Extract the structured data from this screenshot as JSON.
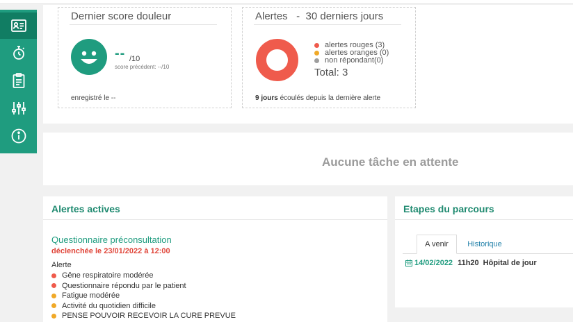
{
  "sidebar": {
    "items": [
      {
        "icon": "id-card-icon",
        "active": true
      },
      {
        "icon": "stopwatch-icon",
        "active": false
      },
      {
        "icon": "clipboard-icon",
        "active": false
      },
      {
        "icon": "sliders-icon",
        "active": false
      },
      {
        "icon": "info-icon",
        "active": false
      }
    ]
  },
  "pain_card": {
    "title": "Dernier score douleur",
    "score_value": "--",
    "score_denominator": "/10",
    "previous_score": "score précédent: --/10",
    "registered": "enregistré le --"
  },
  "alerts_card": {
    "title": "Alertes   -  30 derniers jours",
    "legend": [
      {
        "label": "alertes rouges (3)",
        "color": "#ef5b4c"
      },
      {
        "label": "alertes oranges (0)",
        "color": "#f0a928"
      },
      {
        "label": "non répondant(0)",
        "color": "#9e9e9e"
      }
    ],
    "total": "Total: 3",
    "elapsed_days": "9 jours",
    "elapsed_text": " écoulés depuis la dernière alerte",
    "donut_color": "#ef5b4c"
  },
  "tasks": {
    "empty_text": "Aucune tâche en attente"
  },
  "active_alerts": {
    "title": "Alertes actives",
    "questionnaire_title": "Questionnaire préconsultation",
    "trigger": "déclenchée le 23/01/2022 à 12:00",
    "alert_label": "Alerte",
    "items": [
      {
        "text": "Gêne respiratoire modérée",
        "color": "#ef5b4c"
      },
      {
        "text": "Questionnaire répondu par le patient",
        "color": "#ef5b4c"
      },
      {
        "text": "Fatigue modérée",
        "color": "#f0a928"
      },
      {
        "text": "Activité du quotidien difficile",
        "color": "#f0a928"
      },
      {
        "text": "PENSE POUVOIR RECEVOIR LA CURE PREVUE",
        "color": "#f0a928"
      }
    ]
  },
  "journey": {
    "title": "Etapes du parcours",
    "tabs": {
      "upcoming": "A venir",
      "history": "Historique"
    },
    "steps": [
      {
        "date": "14/02/2022",
        "time": "11h20",
        "place": "Hôpital de jour"
      }
    ]
  },
  "colors": {
    "brand": "#1f9c7f",
    "brand_dark": "#117d63",
    "red": "#ef5b4c",
    "orange": "#f0a928",
    "grey": "#9e9e9e"
  }
}
